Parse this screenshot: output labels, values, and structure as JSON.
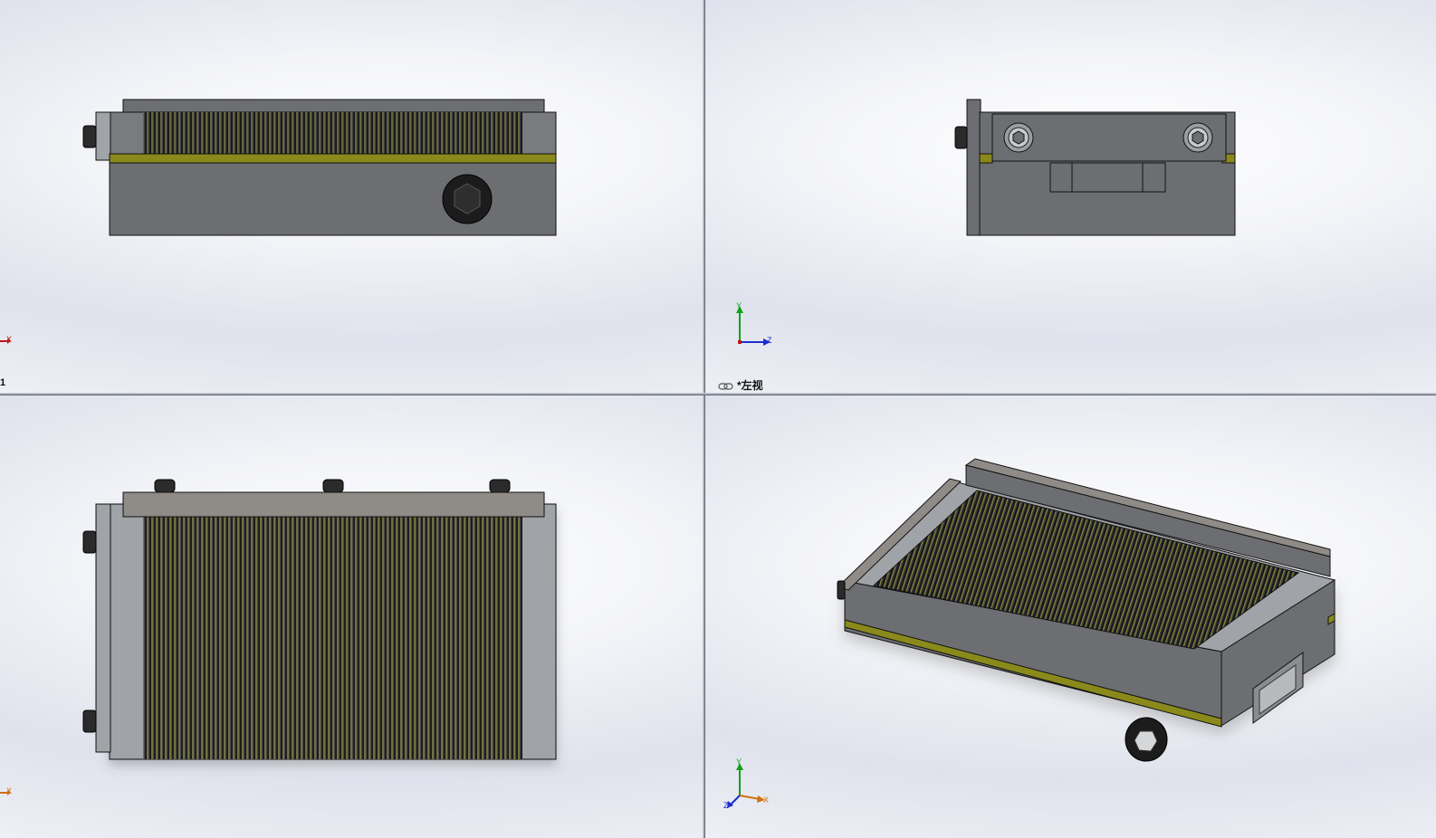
{
  "viewports": {
    "top_left": {
      "label": "1",
      "triad": {
        "x": "X"
      }
    },
    "top_right": {
      "label": "*左视",
      "triad": {
        "y": "Y",
        "z": "Z"
      }
    },
    "bottom_left": {
      "triad": {
        "x": "X"
      }
    },
    "bottom_right": {
      "triad": {
        "y": "Y",
        "z": "Z",
        "x": "X"
      }
    }
  },
  "colors": {
    "body": "#6d6e71",
    "plate": "#a0a3a7",
    "brass": "#8a8a1c",
    "edge": "#1a1a1a",
    "axis_x": "#c0161a",
    "axis_y": "#13a01a",
    "axis_z": "#1a2dd0"
  },
  "icons": [
    "view-link-icon",
    "hex-socket-icon",
    "axis-triad-icon"
  ]
}
